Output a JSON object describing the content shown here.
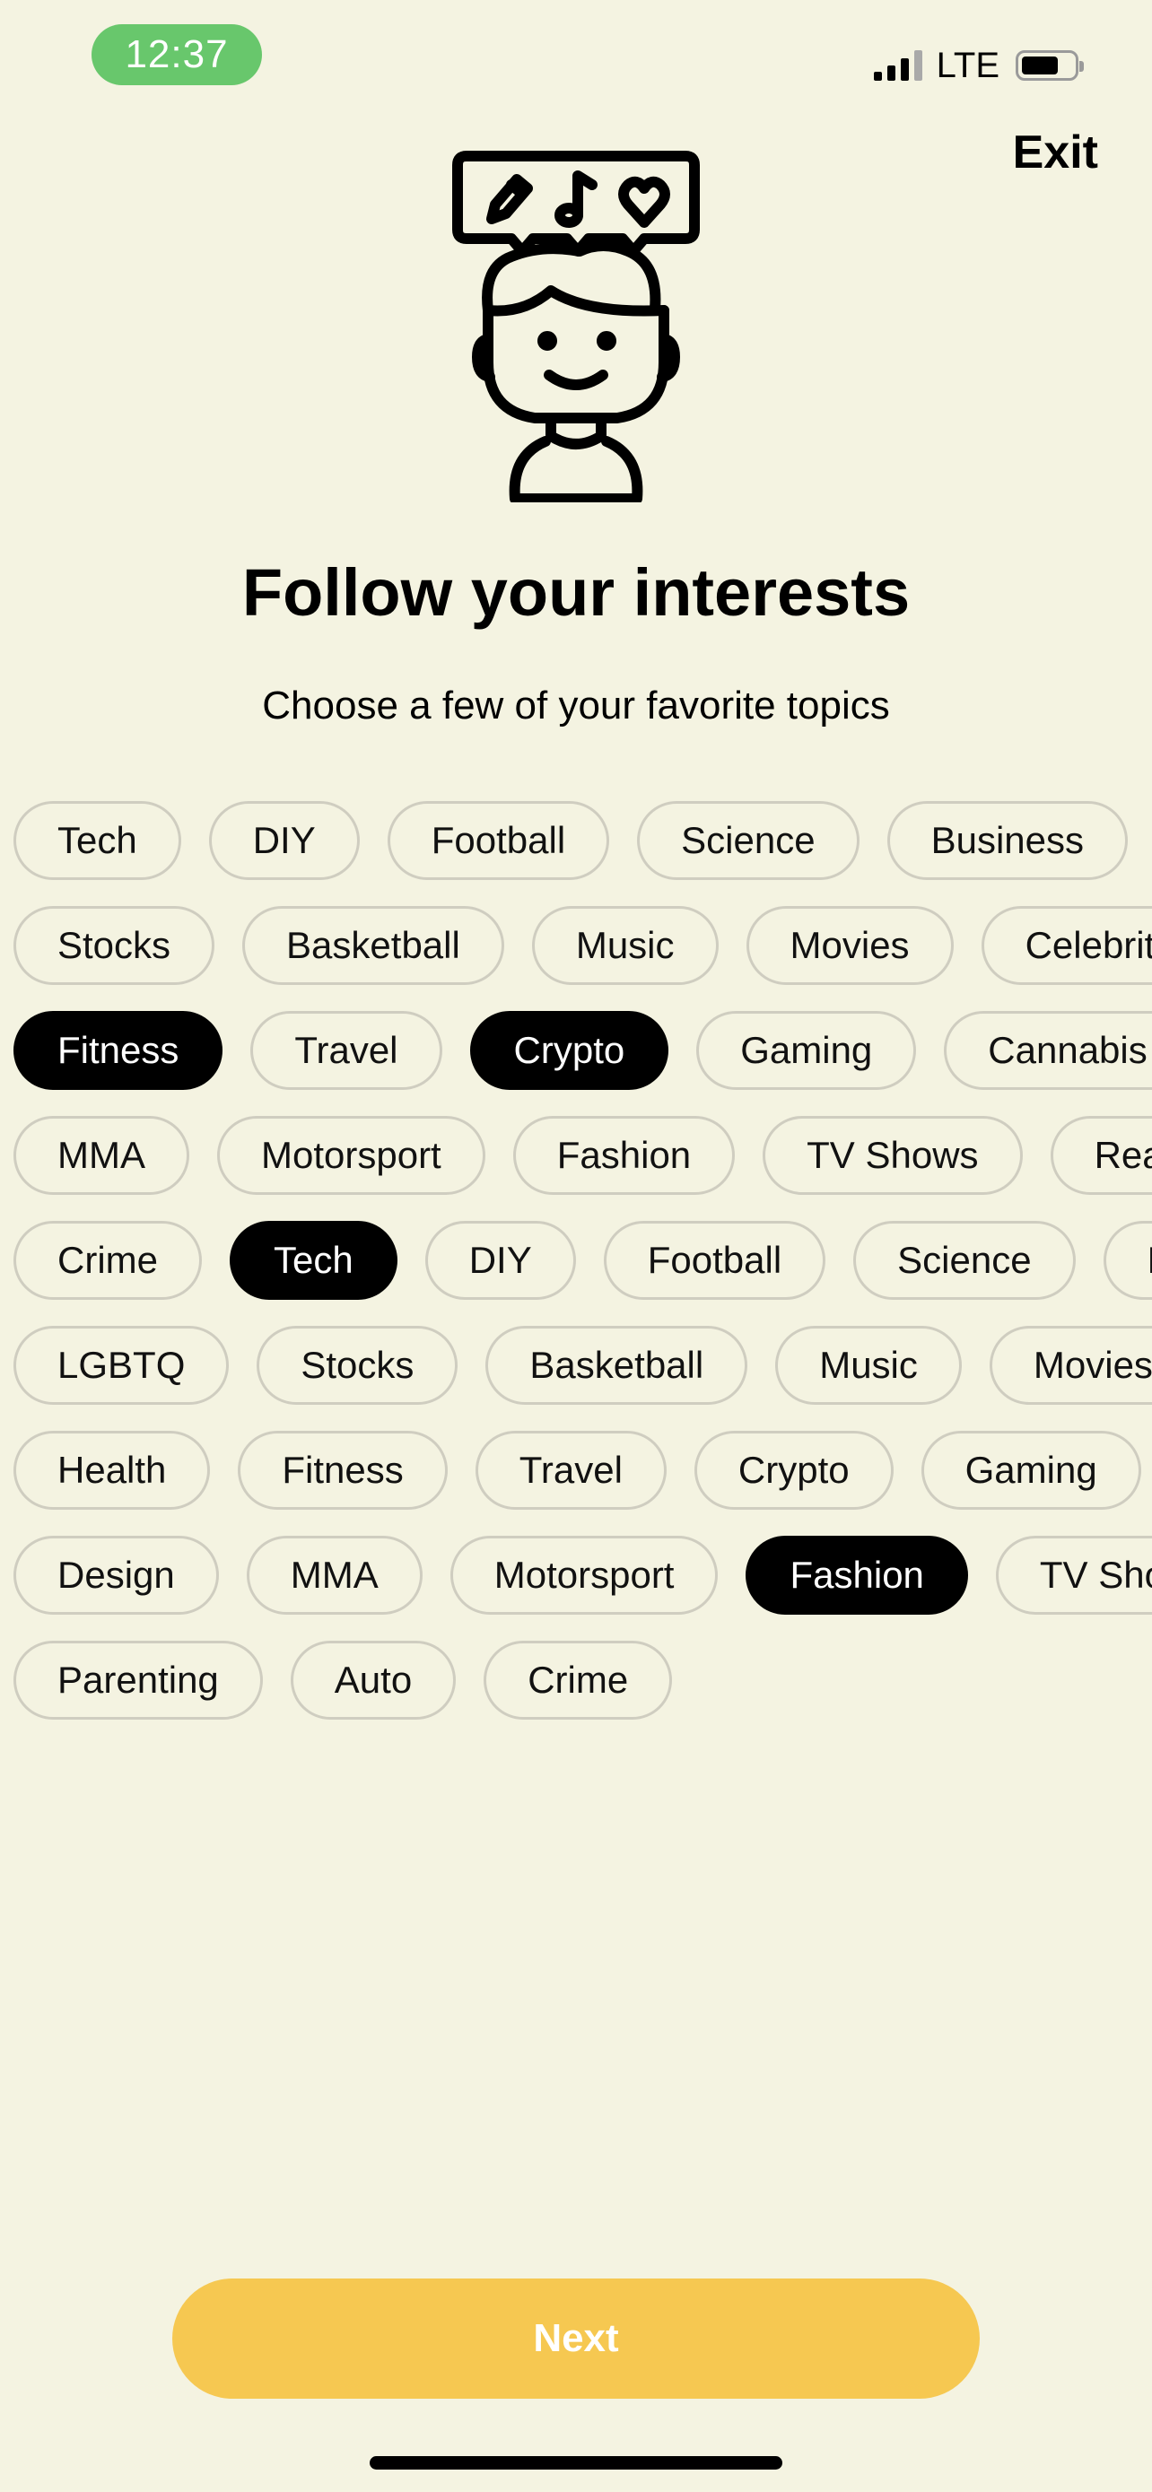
{
  "status_bar": {
    "time": "12:37",
    "network": "LTE",
    "icons": [
      "signal-icon",
      "battery-icon"
    ]
  },
  "header": {
    "exit_label": "Exit"
  },
  "illustration": {
    "icon": "person-with-speech-bubble-icon",
    "bubble_icons": [
      "pencil-icon",
      "music-note-icon",
      "heart-icon"
    ]
  },
  "main": {
    "title": "Follow your interests",
    "subtitle": "Choose a few of your favorite topics"
  },
  "topics": {
    "rows": [
      [
        {
          "label": "Tech",
          "selected": false
        },
        {
          "label": "DIY",
          "selected": false
        },
        {
          "label": "Football",
          "selected": false
        },
        {
          "label": "Science",
          "selected": false
        },
        {
          "label": "Business",
          "selected": false
        }
      ],
      [
        {
          "label": "Stocks",
          "selected": false
        },
        {
          "label": "Basketball",
          "selected": false
        },
        {
          "label": "Music",
          "selected": false
        },
        {
          "label": "Movies",
          "selected": false
        },
        {
          "label": "Celebrities",
          "selected": false
        }
      ],
      [
        {
          "label": "Fitness",
          "selected": true
        },
        {
          "label": "Travel",
          "selected": false
        },
        {
          "label": "Crypto",
          "selected": true
        },
        {
          "label": "Gaming",
          "selected": false
        },
        {
          "label": "Cannabis",
          "selected": false
        }
      ],
      [
        {
          "label": "MMA",
          "selected": false
        },
        {
          "label": "Motorsport",
          "selected": false
        },
        {
          "label": "Fashion",
          "selected": false
        },
        {
          "label": "TV Shows",
          "selected": false
        },
        {
          "label": "Real Estate",
          "selected": false
        }
      ],
      [
        {
          "label": "Crime",
          "selected": false
        },
        {
          "label": "Tech",
          "selected": true
        },
        {
          "label": "DIY",
          "selected": false
        },
        {
          "label": "Football",
          "selected": false
        },
        {
          "label": "Science",
          "selected": false
        },
        {
          "label": "Business",
          "selected": false
        }
      ],
      [
        {
          "label": "LGBTQ",
          "selected": false
        },
        {
          "label": "Stocks",
          "selected": false
        },
        {
          "label": "Basketball",
          "selected": false
        },
        {
          "label": "Music",
          "selected": false
        },
        {
          "label": "Movies",
          "selected": false
        }
      ],
      [
        {
          "label": "Health",
          "selected": false
        },
        {
          "label": "Fitness",
          "selected": false
        },
        {
          "label": "Travel",
          "selected": false
        },
        {
          "label": "Crypto",
          "selected": false
        },
        {
          "label": "Gaming",
          "selected": false
        }
      ],
      [
        {
          "label": "Design",
          "selected": false
        },
        {
          "label": "MMA",
          "selected": false
        },
        {
          "label": "Motorsport",
          "selected": false
        },
        {
          "label": "Fashion",
          "selected": true
        },
        {
          "label": "TV Shows",
          "selected": false
        }
      ],
      [
        {
          "label": "Parenting",
          "selected": false
        },
        {
          "label": "Auto",
          "selected": false
        },
        {
          "label": "Crime",
          "selected": false
        }
      ]
    ]
  },
  "footer": {
    "next_label": "Next"
  },
  "colors": {
    "background": "#f4f3e1",
    "accent": "#f6c851",
    "time_pill": "#68c76c",
    "chip_border": "#cfcdc0",
    "chip_selected": "#000000"
  }
}
